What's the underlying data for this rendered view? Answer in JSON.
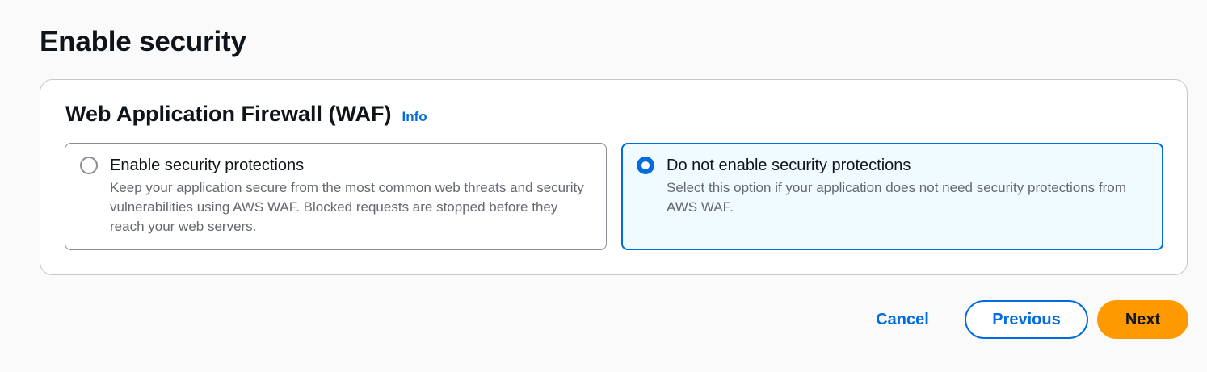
{
  "page": {
    "title": "Enable security"
  },
  "waf_section": {
    "title": "Web Application Firewall (WAF)",
    "info_label": "Info",
    "options": [
      {
        "label": "Enable security protections",
        "description": "Keep your application secure from the most common web threats and security vulnerabilities using AWS WAF. Blocked requests are stopped before they reach your web servers.",
        "selected": false
      },
      {
        "label": "Do not enable security protections",
        "description": "Select this option if your application does not need security protections from AWS WAF.",
        "selected": true
      }
    ]
  },
  "actions": {
    "cancel_label": "Cancel",
    "previous_label": "Previous",
    "next_label": "Next"
  },
  "colors": {
    "accent": "#006ce0",
    "primary_button": "#ff9900",
    "selected_tile_bg": "#f0fbff"
  }
}
